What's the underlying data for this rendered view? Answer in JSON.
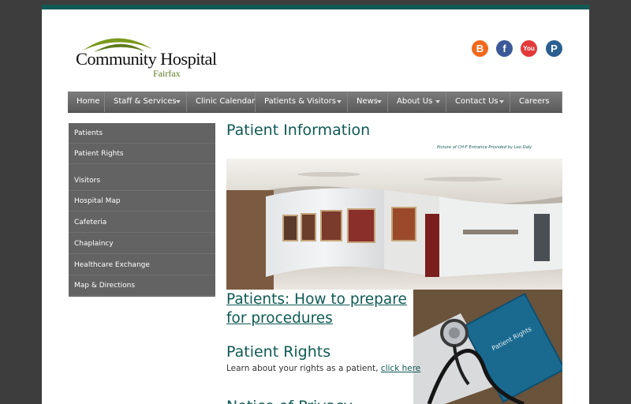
{
  "logo": {
    "name": "Community Hospital",
    "subtitle": "Fairfax"
  },
  "social": [
    {
      "icon": "blogger-icon",
      "glyph": "B",
      "color": "#f06a1d"
    },
    {
      "icon": "facebook-icon",
      "glyph": "f",
      "color": "#3b5998"
    },
    {
      "icon": "youtube-icon",
      "glyph": "You",
      "color": "#e23a3a"
    },
    {
      "icon": "paypal-icon",
      "glyph": "P",
      "color": "#2b5f91"
    }
  ],
  "nav": {
    "items": [
      {
        "label": "Home",
        "dropdown": false
      },
      {
        "label": "Staff & Services",
        "dropdown": true
      },
      {
        "label": "Clinic Calendar",
        "dropdown": false
      },
      {
        "label": "Patients & Visitors",
        "dropdown": true
      },
      {
        "label": "News",
        "dropdown": true
      },
      {
        "label": "About Us",
        "dropdown": true
      },
      {
        "label": "Contact Us",
        "dropdown": true
      },
      {
        "label": "Careers",
        "dropdown": false
      }
    ]
  },
  "sidebar": {
    "items": [
      {
        "label": "Patients"
      },
      {
        "label": "Patient Rights"
      },
      {
        "label": "Visitors"
      },
      {
        "label": "Hospital Map"
      },
      {
        "label": "Cafeteria"
      },
      {
        "label": "Chaplaincy"
      },
      {
        "label": "Healthcare Exchange"
      },
      {
        "label": "Map & Directions"
      }
    ]
  },
  "main": {
    "title": "Patient Information",
    "photo_credit": "Picture of CH-F Entrance Provided by Leo Daly",
    "procedures_link": "Patients: How to prepare for procedures",
    "rights_heading": "Patient Rights",
    "rights_text": "Learn about your rights as a patient,",
    "rights_link": "click here",
    "privacy_heading": "Notice of Privacy",
    "folder_label": "Patient Rights"
  },
  "colors": {
    "brand": "#0f5a54",
    "logo_green": "#7a9a1c",
    "nav": "#666666"
  }
}
